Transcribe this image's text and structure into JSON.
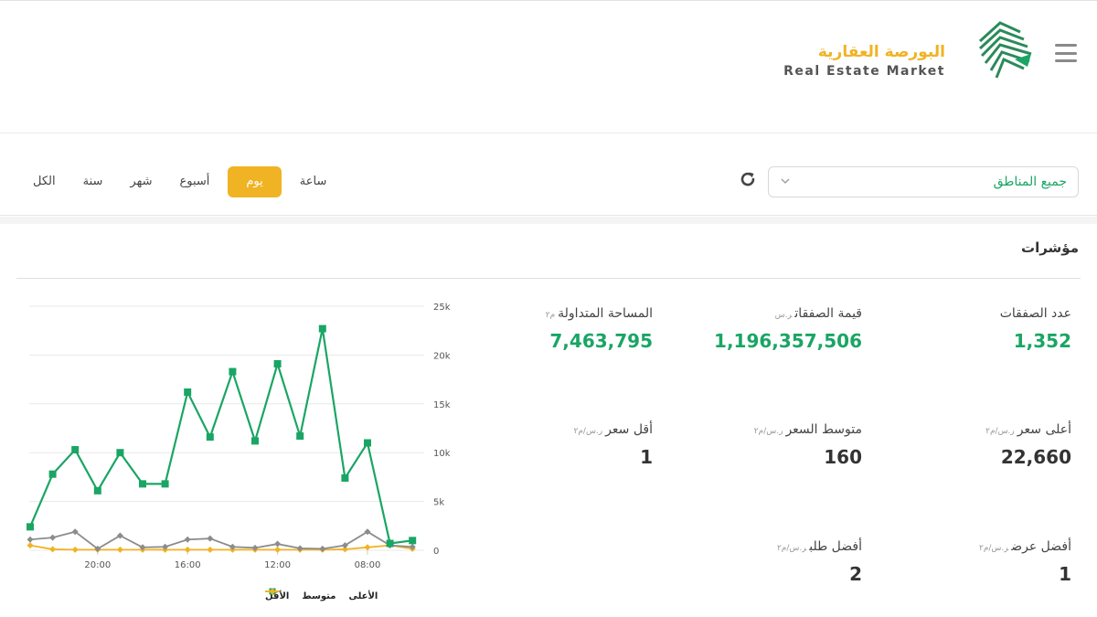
{
  "header": {
    "logo_arabic": "البورصة العقارية",
    "logo_english": "Real Estate Market",
    "colors": {
      "brand_gold": "#f0b323",
      "brand_green": "#1aa564",
      "logo_dark": "#444444"
    }
  },
  "filters": {
    "region_value": "جميع المناطق",
    "refresh_icon": "refresh-icon",
    "tabs": [
      {
        "label": "ساعة",
        "active": false
      },
      {
        "label": "يوم",
        "active": true
      },
      {
        "label": "أسبوع",
        "active": false
      },
      {
        "label": "شهر",
        "active": false
      },
      {
        "label": "سنة",
        "active": false
      },
      {
        "label": "الكل",
        "active": false
      }
    ]
  },
  "indicators": {
    "title": "مؤشرات",
    "deals_count": {
      "label": "عدد الصفقات",
      "unit": "",
      "value": "1,352"
    },
    "deals_value": {
      "label": "قيمة الصفقات",
      "unit": "ر.س",
      "value": "1,196,357,506"
    },
    "traded_area": {
      "label": "المساحة المتداولة",
      "unit": "م٢",
      "value": "7,463,795"
    },
    "max_price": {
      "label": "أعلى سعر",
      "unit": "ر.س/م٢",
      "value": "22,660"
    },
    "avg_price": {
      "label": "متوسط السعر",
      "unit": "ر.س/م٢",
      "value": "160"
    },
    "min_price": {
      "label": "أقل سعر",
      "unit": "ر.س/م٢",
      "value": "1"
    },
    "best_offer": {
      "label": "أفضل عرض",
      "unit": "ر.س/م٢",
      "value": "1"
    },
    "best_bid": {
      "label": "أفضل طلب",
      "unit": "ر.س/م٢",
      "value": "2"
    }
  },
  "chart_data": {
    "type": "line",
    "x_tick_labels": [
      "20:00",
      "16:00",
      "12:00",
      "08:00"
    ],
    "y_tick_labels": [
      "0",
      "5k",
      "10k",
      "15k",
      "20k",
      "25k"
    ],
    "ylim": [
      0,
      25000
    ],
    "grid": true,
    "legend_position": "bottom-right",
    "series": [
      {
        "name": "الأعلى",
        "color": "#1aa564",
        "marker": "square",
        "values": [
          2400,
          7800,
          10300,
          6100,
          10000,
          6800,
          6800,
          16200,
          11600,
          18300,
          11200,
          19100,
          11700,
          22700,
          7400,
          11000,
          700,
          1000
        ]
      },
      {
        "name": "متوسط",
        "color": "#8c8c8c",
        "marker": "diamond",
        "values": [
          1100,
          1300,
          1900,
          150,
          1500,
          300,
          350,
          1100,
          1200,
          350,
          250,
          650,
          200,
          150,
          500,
          1900,
          500,
          350
        ]
      },
      {
        "name": "الأقل",
        "color": "#f0b323",
        "marker": "diamond",
        "values": [
          500,
          100,
          60,
          60,
          60,
          60,
          60,
          60,
          60,
          60,
          60,
          60,
          60,
          60,
          100,
          300,
          500,
          150
        ]
      }
    ]
  }
}
